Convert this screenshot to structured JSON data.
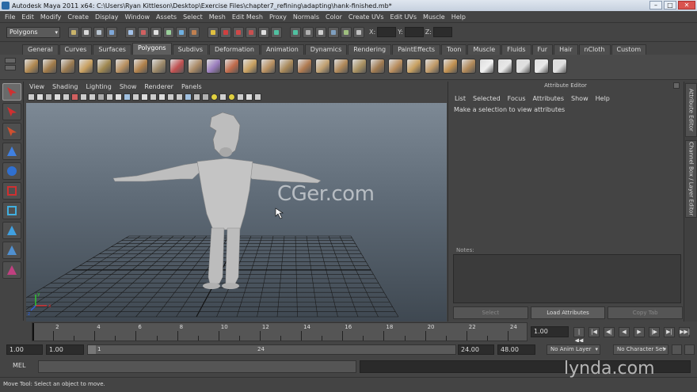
{
  "window": {
    "title": "Autodesk Maya 2011 x64: C:\\Users\\Ryan Kittleson\\Desktop\\Exercise Files\\chapter7_refining\\adapting\\hank-finished.mb*",
    "minimize": "–",
    "maximize": "□",
    "close": "✕"
  },
  "menubar": [
    "File",
    "Edit",
    "Modify",
    "Create",
    "Display",
    "Window",
    "Assets",
    "Select",
    "Mesh",
    "Edit Mesh",
    "Proxy",
    "Normals",
    "Color",
    "Create UVs",
    "Edit UVs",
    "Muscle",
    "Help"
  ],
  "statusline": {
    "mode": "Polygons",
    "x_label": "X:",
    "y_label": "Y:",
    "z_label": "Z:",
    "icon_colors": [
      "#c9b36a",
      "#d9d9d9",
      "#b8c4d0",
      "#7fa7d8",
      "#a4c2e8",
      "#d06060",
      "#e0e0e0",
      "#9ad09a",
      "#70b0e0",
      "#c08050",
      "#e0c040",
      "#d04040",
      "#d04848",
      "#c85050",
      "#e0e0e0",
      "#50c0a0",
      "#50c0a0",
      "#b0b0b0",
      "#d0d0d0",
      "#7f9fbf",
      "#9fbf7f",
      "#c0c0c0"
    ]
  },
  "shelf_tabs": [
    "General",
    "Curves",
    "Surfaces",
    "Polygons",
    "Subdivs",
    "Deformation",
    "Animation",
    "Dynamics",
    "Rendering",
    "PaintEffects",
    "Toon",
    "Muscle",
    "Fluids",
    "Fur",
    "Hair",
    "nCloth",
    "Custom"
  ],
  "shelf_active_tab": "Polygons",
  "shelf_icon_colors": [
    "#b08850",
    "#a07a48",
    "#9a7a50",
    "#c8a060",
    "#a08850",
    "#b89060",
    "#b0804a",
    "#9c8868",
    "#c05050",
    "#aa8a66",
    "#9a7cbd",
    "#c06a4a",
    "#c8a060",
    "#b89060",
    "#a88858",
    "#b07a50",
    "#c0a070",
    "#b08858",
    "#a89060",
    "#a07a50",
    "#b88c5c",
    "#c8a060",
    "#c09a68",
    "#c09050",
    "#b08858",
    "#f0f0f0",
    "#e8e8e8",
    "#e0e0e0",
    "#e8e8e8",
    "#e0e0e0"
  ],
  "toolbox": [
    {
      "name": "select-tool",
      "color": "#d03030",
      "shape": "arrow"
    },
    {
      "name": "lasso-tool",
      "color": "#d03030",
      "shape": "arrow"
    },
    {
      "name": "paint-select-tool",
      "color": "#d05030",
      "shape": "arrow"
    },
    {
      "name": "move-tool",
      "color": "#4080e0",
      "shape": "tri"
    },
    {
      "name": "rotate-tool",
      "color": "#3070d0",
      "shape": "round"
    },
    {
      "name": "scale-tool",
      "color": "#d03030",
      "shape": "cube"
    },
    {
      "name": "manipulator-tool",
      "color": "#40b0e0",
      "shape": "cube"
    },
    {
      "name": "soft-mod-tool",
      "color": "#40a0e0",
      "shape": "tri"
    },
    {
      "name": "show-manipulator-tool",
      "color": "#5090d0",
      "shape": "tri"
    },
    {
      "name": "last-tool",
      "color": "#c04080",
      "shape": "tri"
    }
  ],
  "viewport": {
    "menu": [
      "View",
      "Shading",
      "Lighting",
      "Show",
      "Renderer",
      "Panels"
    ],
    "tool_colors": [
      "#cccccc",
      "#dddddd",
      "#bbbbbb",
      "#dddddd",
      "#cccccc",
      "#d06060",
      "#cccccc",
      "#cccccc",
      "#aaaaaa",
      "#cccccc",
      "#e0e0e0",
      "#a0c0e0",
      "#cccccc",
      "#dddddd",
      "#cccccc",
      "#dddddd",
      "#cccccc",
      "#cccccc",
      "#a0c0e0",
      "#c0c0c0",
      "#b0b0b0",
      "#e0d040",
      "#d0d0d0",
      "#e0d040",
      "#cccccc",
      "#dddddd",
      "#cccccc"
    ],
    "watermark": "CGer.com",
    "axis_x": "x",
    "axis_y": "y",
    "axis_z": "z"
  },
  "attribute_editor": {
    "title": "Attribute Editor",
    "menu": [
      "List",
      "Selected",
      "Focus",
      "Attributes",
      "Show",
      "Help"
    ],
    "message": "Make a selection to view attributes",
    "notes_label": "Notes:",
    "buttons": {
      "select": "Select",
      "load": "Load Attributes",
      "copy_tab": "Copy Tab"
    }
  },
  "side_tabs": {
    "attribute_editor": "Attribute Editor",
    "channel_box": "Channel Box / Layer Editor"
  },
  "time_slider": {
    "ticks": [
      "2",
      "4",
      "6",
      "8",
      "10",
      "12",
      "14",
      "16",
      "18",
      "20",
      "22",
      "24"
    ],
    "current_frame": "1.00",
    "playback": [
      "|◀◀",
      "|◀",
      "◀|",
      "◀",
      "▶",
      "|▶",
      "▶|",
      "▶▶|"
    ]
  },
  "range_slider": {
    "start": "1.00",
    "playback_start": "1.00",
    "range_label_start": "1",
    "range_label_end": "24",
    "playback_end": "24.00",
    "end": "48.00",
    "anim_layer": "No Anim Layer",
    "character_set": "No Character Set"
  },
  "command_line": {
    "label": "MEL"
  },
  "help_line": {
    "text": "Move Tool: Select an object to move."
  },
  "branding": {
    "lynda": "lynda.com"
  }
}
